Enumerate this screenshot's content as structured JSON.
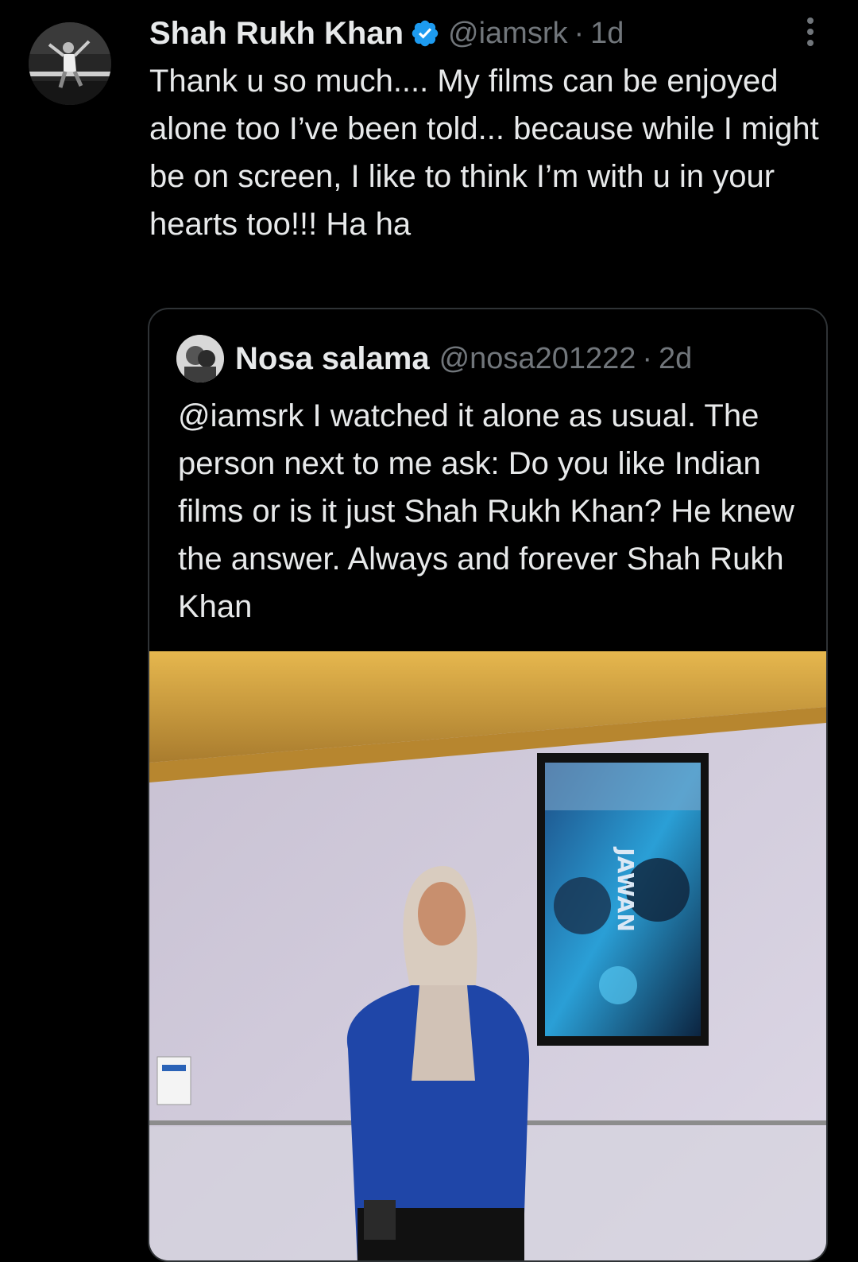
{
  "tweet": {
    "author_name": "Shah Rukh Khan",
    "handle": "@iamsrk",
    "separator": "·",
    "time": "1d",
    "text": "Thank u so much.... My films can be enjoyed alone too I’ve been told... because while I might be on screen, I like to think I’m with u in your hearts too!!! Ha ha",
    "icons": {
      "verified": "verified-badge-icon",
      "more": "more-options-icon"
    },
    "verified_color": "#1d9bf0"
  },
  "quoted_tweet": {
    "author_name": "Nosa salama",
    "handle": "@nosa201222",
    "separator": "·",
    "time": "2d",
    "text": "@iamsrk I watched it alone as usual. The person next to me ask: Do you like Indian films or is it just Shah Rukh Khan? He knew the answer. Always and forever Shah Rukh Khan",
    "media": {
      "poster_title": "JAWAN"
    }
  }
}
